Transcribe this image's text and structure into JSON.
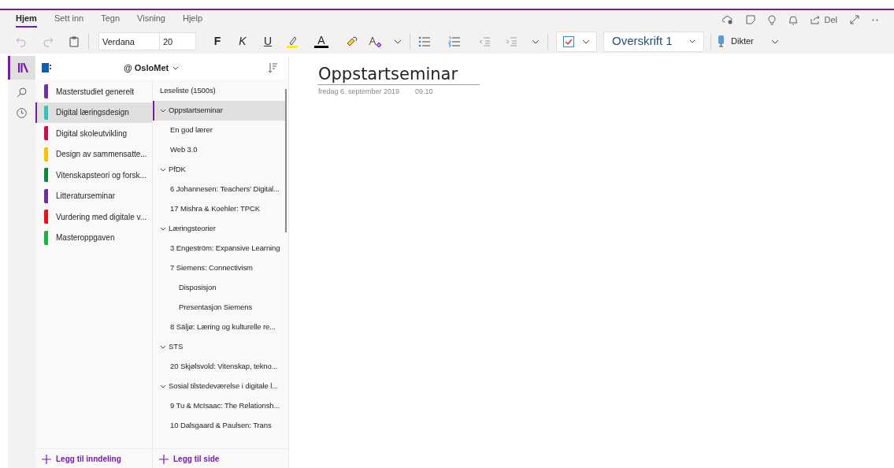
{
  "ribbon_tabs": [
    {
      "label": "Hjem",
      "selected": true
    },
    {
      "label": "Sett inn",
      "selected": false
    },
    {
      "label": "Tegn",
      "selected": false
    },
    {
      "label": "Visning",
      "selected": false
    },
    {
      "label": "Hjelp",
      "selected": false
    }
  ],
  "share_label": "Del",
  "toolbar": {
    "font": "Verdana",
    "size": "20",
    "bold": "F",
    "italic": "K",
    "underline": "U",
    "font_color": "A",
    "style": "Overskrift 1",
    "dictate": "Dikter"
  },
  "notebook": {
    "name": "@ OsloMet"
  },
  "sections": [
    {
      "label": "Masterstudiet generelt",
      "color": "#7030a0",
      "selected": false
    },
    {
      "label": "Digital læringsdesign",
      "color": "#2ec4b6",
      "selected": true
    },
    {
      "label": "Digital skoleutvikling",
      "color": "#c7114f",
      "selected": false
    },
    {
      "label": "Design av sammensatte...",
      "color": "#ffc000",
      "selected": false
    },
    {
      "label": "Vitenskapsteori og forsk...",
      "color": "#0b8a3e",
      "selected": false
    },
    {
      "label": "Litteraturseminar",
      "color": "#6b2fa0",
      "selected": false
    },
    {
      "label": "Vurdering med digitale v...",
      "color": "#e8101e",
      "selected": false
    },
    {
      "label": "Masteroppgaven",
      "color": "#17b24a",
      "selected": false
    }
  ],
  "pages": [
    {
      "label": "Leseliste (1500s)",
      "selected": false
    },
    {
      "label": "Oppstartseminar",
      "selected": true,
      "expanded": true,
      "children": [
        {
          "label": "En god lærer",
          "selected": false
        },
        {
          "label": "Web 3.0",
          "selected": false
        }
      ]
    },
    {
      "label": "PfDK",
      "selected": false,
      "expanded": true,
      "children": [
        {
          "label": "6 Johannesen: Teachers' Digital...",
          "selected": false
        },
        {
          "label": "17 Mishra & Koehler: TPCK",
          "selected": false
        }
      ]
    },
    {
      "label": "Læringsteorier",
      "selected": false,
      "expanded": true,
      "children": [
        {
          "label": "3 Engeström: Expansive Learning",
          "selected": false
        },
        {
          "label": "7 Siemens: Connectivism",
          "selected": false,
          "children": [
            {
              "label": "Disposisjon",
              "selected": false
            },
            {
              "label": "Presentasjon Siemens",
              "selected": false
            }
          ]
        },
        {
          "label": "8 Säljø: Læring og kulturelle re...",
          "selected": false
        }
      ]
    },
    {
      "label": "STS",
      "selected": false,
      "expanded": true,
      "children": [
        {
          "label": "20 Skjølsvold: Vitenskap, tekno...",
          "selected": false
        }
      ]
    },
    {
      "label": "Sosial tilstedeværelse i digitale l...",
      "selected": false,
      "expanded": true,
      "children": [
        {
          "label": "9 Tu & McIsaac: The Relationsh...",
          "selected": false
        },
        {
          "label": "10 Dalsgaard & Paulsen: Trans",
          "selected": false
        }
      ]
    }
  ],
  "add_section": "Legg til inndeling",
  "add_page": "Legg til side",
  "page": {
    "title": "Oppstartseminar",
    "date": "fredag 6. september 2019",
    "time": "09.10"
  }
}
